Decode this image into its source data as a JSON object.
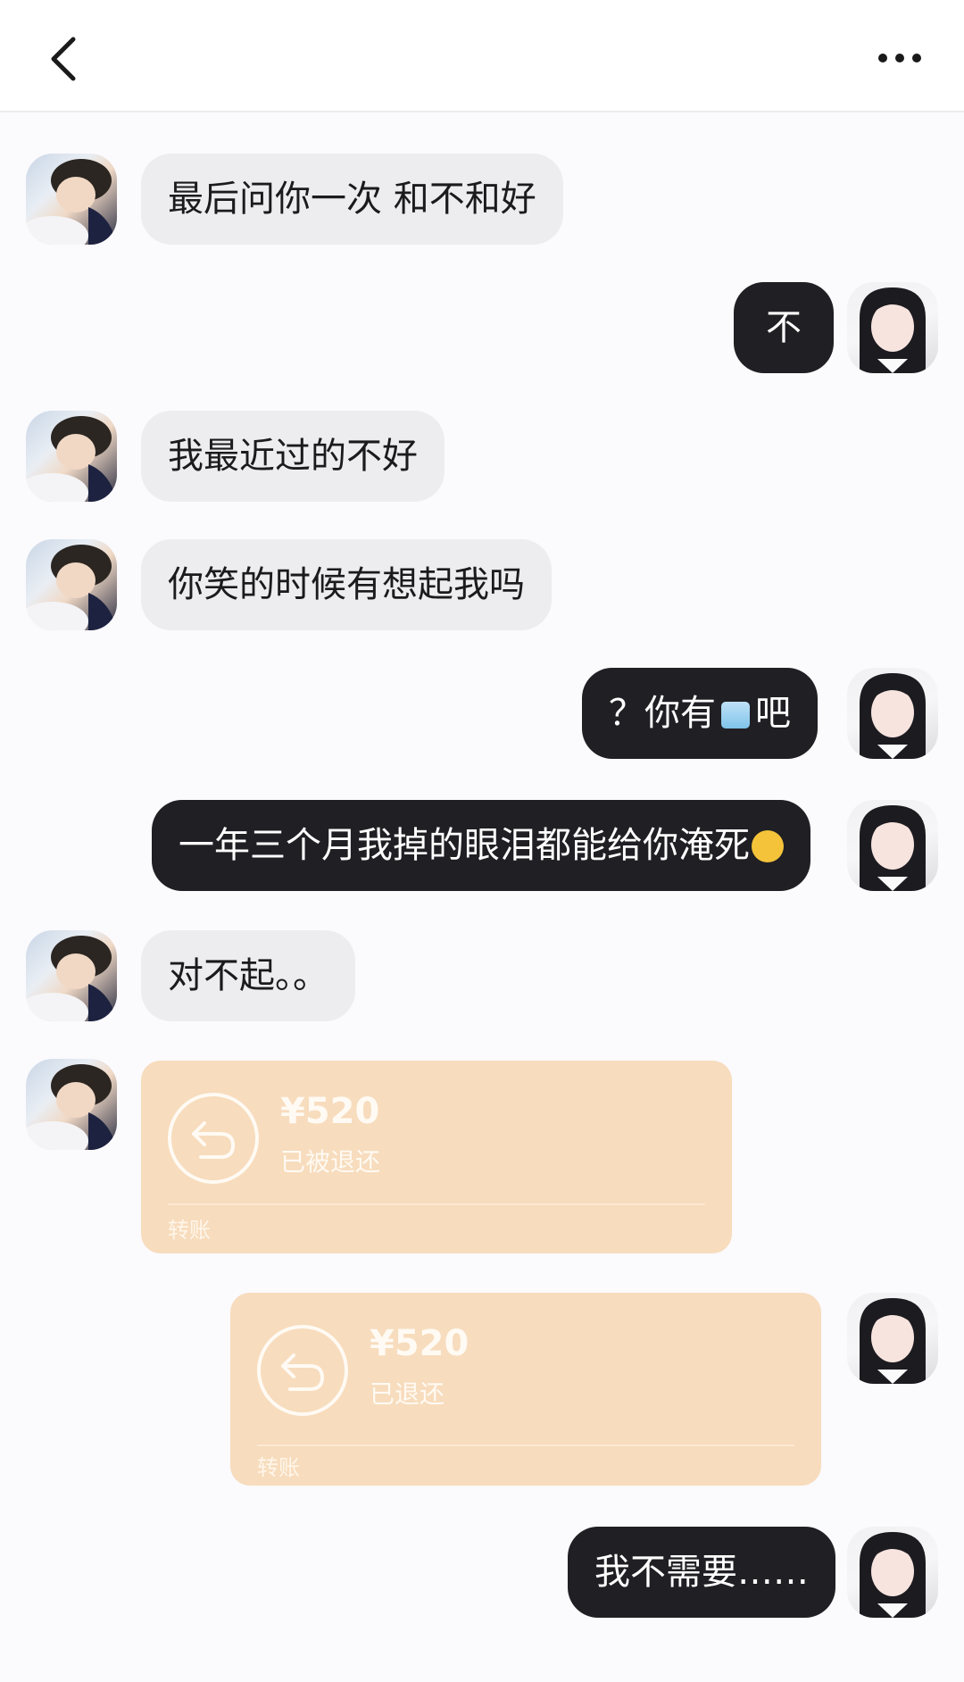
{
  "header": {
    "back_icon": "chevron-left-icon",
    "more_icon": "more-horizontal-icon"
  },
  "messages": [
    {
      "from": "other",
      "text": "最后问你一次 和不和好"
    },
    {
      "from": "me",
      "text": "不"
    },
    {
      "from": "other",
      "text": "我最近过的不好"
    },
    {
      "from": "other",
      "text": "你笑的时候有想起我吗"
    },
    {
      "from": "me",
      "text_before": "？你有",
      "emoji": "ice-cube-emoji",
      "text_after": "吧"
    },
    {
      "from": "me",
      "text": "一年三个月我掉的眼泪都能给你淹死",
      "emoji": "rolling-laughing-emoji"
    },
    {
      "from": "other",
      "text": "对不起。。"
    },
    {
      "from": "other",
      "type": "transfer",
      "amount": "¥520",
      "status": "已被退还",
      "label": "转账",
      "icon": "return-arrow-icon"
    },
    {
      "from": "me",
      "type": "transfer",
      "amount": "¥520",
      "status": "已退还",
      "label": "转账",
      "icon": "return-arrow-icon"
    },
    {
      "from": "me",
      "text": "我不需要……"
    }
  ],
  "colors": {
    "incoming_bubble": "#ededf0",
    "outgoing_bubble": "#1f1f24",
    "transfer_card": "#f7dcbd",
    "background": "#fbfafd"
  }
}
